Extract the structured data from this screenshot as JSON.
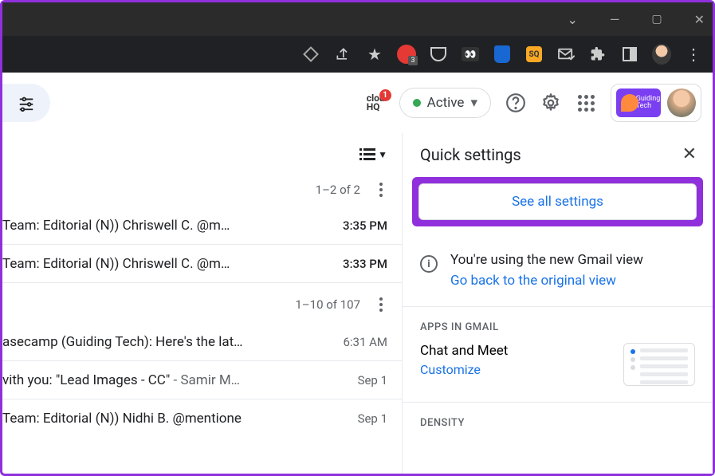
{
  "titlebar": {
    "minimize": "—",
    "maximize": "❐",
    "close": "✕"
  },
  "browser": {
    "star": "★",
    "share": "↗",
    "sq_text": "SQ",
    "eyes": "••",
    "dots": "⋮"
  },
  "header": {
    "clouhq_top": "clou",
    "clouhq_bottom": "HQ",
    "clouhq_badge": "1",
    "active_label": "Active",
    "gt_line1": "Guiding",
    "gt_line2": "Tech"
  },
  "mail": {
    "count1": "1–2 of 2",
    "rows1": [
      {
        "subject": "Team: Editorial (N)) Chriswell C. @m…",
        "time": "3:35 PM"
      },
      {
        "subject": "Team: Editorial (N)) Chriswell C. @m…",
        "time": "3:33 PM"
      }
    ],
    "count2": "1–10 of 107",
    "rows2": [
      {
        "subject": "asecamp (Guiding Tech): Here's the lat…",
        "faded": "",
        "time": "6:31 AM"
      },
      {
        "subject": "vith you: \"Lead Images - CC\" ",
        "faded": "- Samir M…",
        "time": "Sep 1"
      },
      {
        "subject": "Team: Editorial (N)) Nidhi B. @mentione",
        "faded": "",
        "time": "Sep 1"
      }
    ]
  },
  "settings": {
    "title": "Quick settings",
    "see_all": "See all settings",
    "new_view_msg": "You're using the new Gmail view",
    "go_back": "Go back to the original view",
    "apps_label": "APPS IN GMAIL",
    "chat_meet": "Chat and Meet",
    "customize": "Customize",
    "density": "DENSITY",
    "close": "✕",
    "info": "i"
  }
}
